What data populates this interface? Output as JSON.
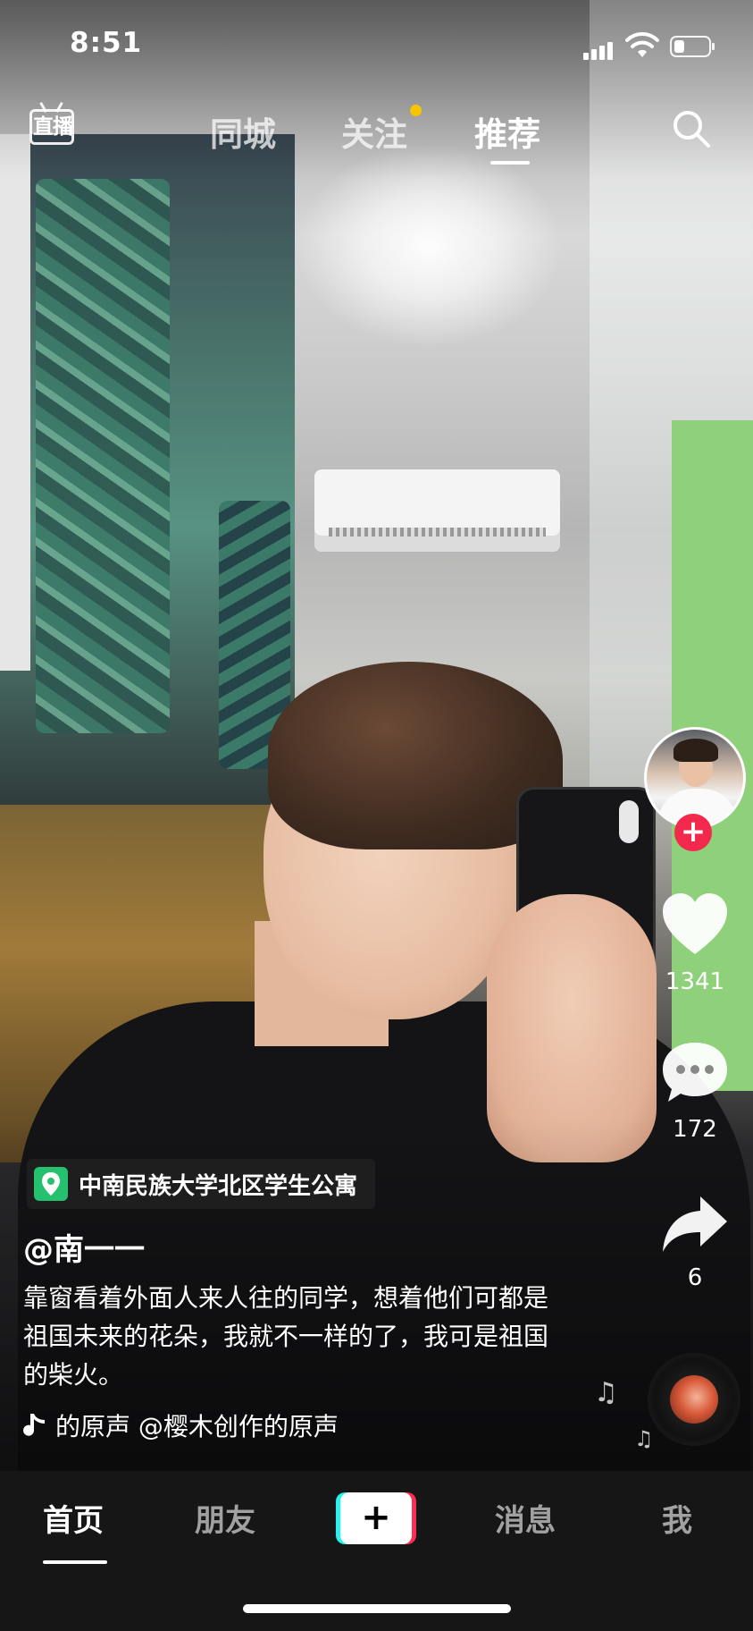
{
  "status_bar": {
    "time": "8:51",
    "battery_level": 0.3
  },
  "top_nav": {
    "live_label": "直播",
    "tabs": [
      {
        "label": "同城",
        "active": false
      },
      {
        "label": "关注",
        "active": false,
        "has_dot": true
      },
      {
        "label": "推荐",
        "active": true
      }
    ],
    "dot_color": "#f7c500"
  },
  "right_rail": {
    "likes": "1341",
    "comments": "172",
    "shares": "6",
    "follow_color": "#f2294d"
  },
  "post": {
    "location": "中南民族大学北区学生公寓",
    "author": "@南一一",
    "description": "靠窗看着外面人来人往的同学，想着他们可都是祖国未来的花朵，我就不一样的了，我可是祖国的柴火。",
    "music": "的原声    @樱木创作的原声"
  },
  "bottom_tabs": [
    {
      "label": "首页",
      "active": true
    },
    {
      "label": "朋友",
      "active": false
    },
    {
      "label": "消息",
      "active": false
    },
    {
      "label": "我",
      "active": false
    }
  ],
  "create_button": {
    "label": "+",
    "accent_left": "#25f4ee",
    "accent_right": "#fe2c55"
  },
  "icons": [
    "live-icon",
    "search-icon",
    "heart-icon",
    "comment-icon",
    "share-icon",
    "music-note-icon",
    "location-pin-icon",
    "plus-icon"
  ]
}
